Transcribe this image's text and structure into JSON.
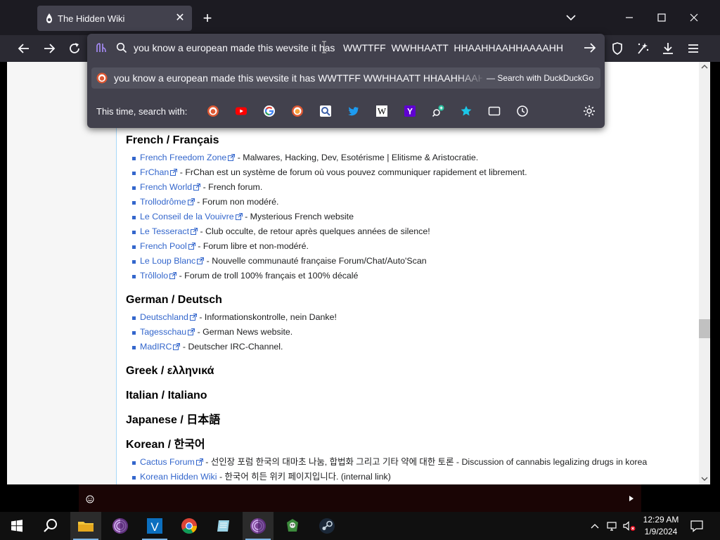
{
  "browser": {
    "tab_title": "The Hidden Wiki",
    "urlbar_value": "you know a european made this wevsite it has   WWTTFF  WWHHAATT  HHAAHHAAHHAAAAHH",
    "suggestion_text": "you know a european made this wevsite it has WWTTFF WWHHAATT HHAAHHAAHHAAAAHH",
    "suggestion_action": "— Search with DuckDuckGo",
    "search_with_label": "This time, search with:",
    "search_engines": [
      "duckduckgo",
      "youtube",
      "google",
      "duckduckgo-onion",
      "startpage",
      "twitter",
      "wikipedia",
      "yahoo",
      "add-engine",
      "bookmarks",
      "tabs",
      "history"
    ]
  },
  "page": {
    "sections": [
      {
        "heading": "French / Français",
        "items": [
          {
            "link": "French Freedom Zone",
            "desc": " - Malwares, Hacking, Dev, Esotérisme | Elitisme & Aristocratie."
          },
          {
            "link": "FrChan",
            "desc": " - FrChan est un système de forum où vous pouvez communiquer rapidement et librement."
          },
          {
            "link": "French World",
            "desc": " - French forum."
          },
          {
            "link": "Trollodrôme",
            "desc": " - Forum non modéré."
          },
          {
            "link": "Le Conseil de la Vouivre",
            "desc": " - Mysterious French website"
          },
          {
            "link": "Le Tesseract",
            "desc": " - Club occulte, de retour après quelques années de silence!"
          },
          {
            "link": "French Pool",
            "desc": " - Forum libre et non-modéré."
          },
          {
            "link": "Le Loup Blanc",
            "desc": " - Nouvelle communauté française Forum/Chat/Auto'Scan"
          },
          {
            "link": "Trôllolo",
            "desc": " - Forum de troll 100% français et 100% décalé"
          }
        ]
      },
      {
        "heading": "German / Deutsch",
        "items": [
          {
            "link": "Deutschland",
            "desc": " - Informationskontrolle, nein Danke!"
          },
          {
            "link": "Tagesschau",
            "desc": " - German News website."
          },
          {
            "link": "MadIRC",
            "desc": " - Deutscher IRC-Channel."
          }
        ]
      },
      {
        "heading": "Greek / ελληνικά",
        "items": []
      },
      {
        "heading": "Italian / Italiano",
        "items": []
      },
      {
        "heading": "Japanese / 日本語",
        "items": []
      },
      {
        "heading": "Korean / 한국어",
        "items": [
          {
            "link": "Cactus Forum",
            "desc": " - 선인장 포럼 한국의 대마초 나눔, 합법화 그리고 기타 약에 대한 토론 - Discussion of cannabis legalizing drugs in korea"
          },
          {
            "link": "Korean Hidden Wiki",
            "desc": " - 한국어 히든 위키 페이지입니다. (internal link)"
          }
        ]
      }
    ]
  },
  "taskbar": {
    "time": "12:29 AM",
    "date": "1/9/2024",
    "apps": [
      "start",
      "search",
      "file-explorer",
      "tor-browser",
      "vs-code",
      "chrome",
      "notepad",
      "tor-browser-2",
      "game-app",
      "steam"
    ]
  },
  "colors": {
    "link": "#3366cc",
    "tab_bg": "#42414d",
    "toolbar_bg": "#2b2a33"
  }
}
